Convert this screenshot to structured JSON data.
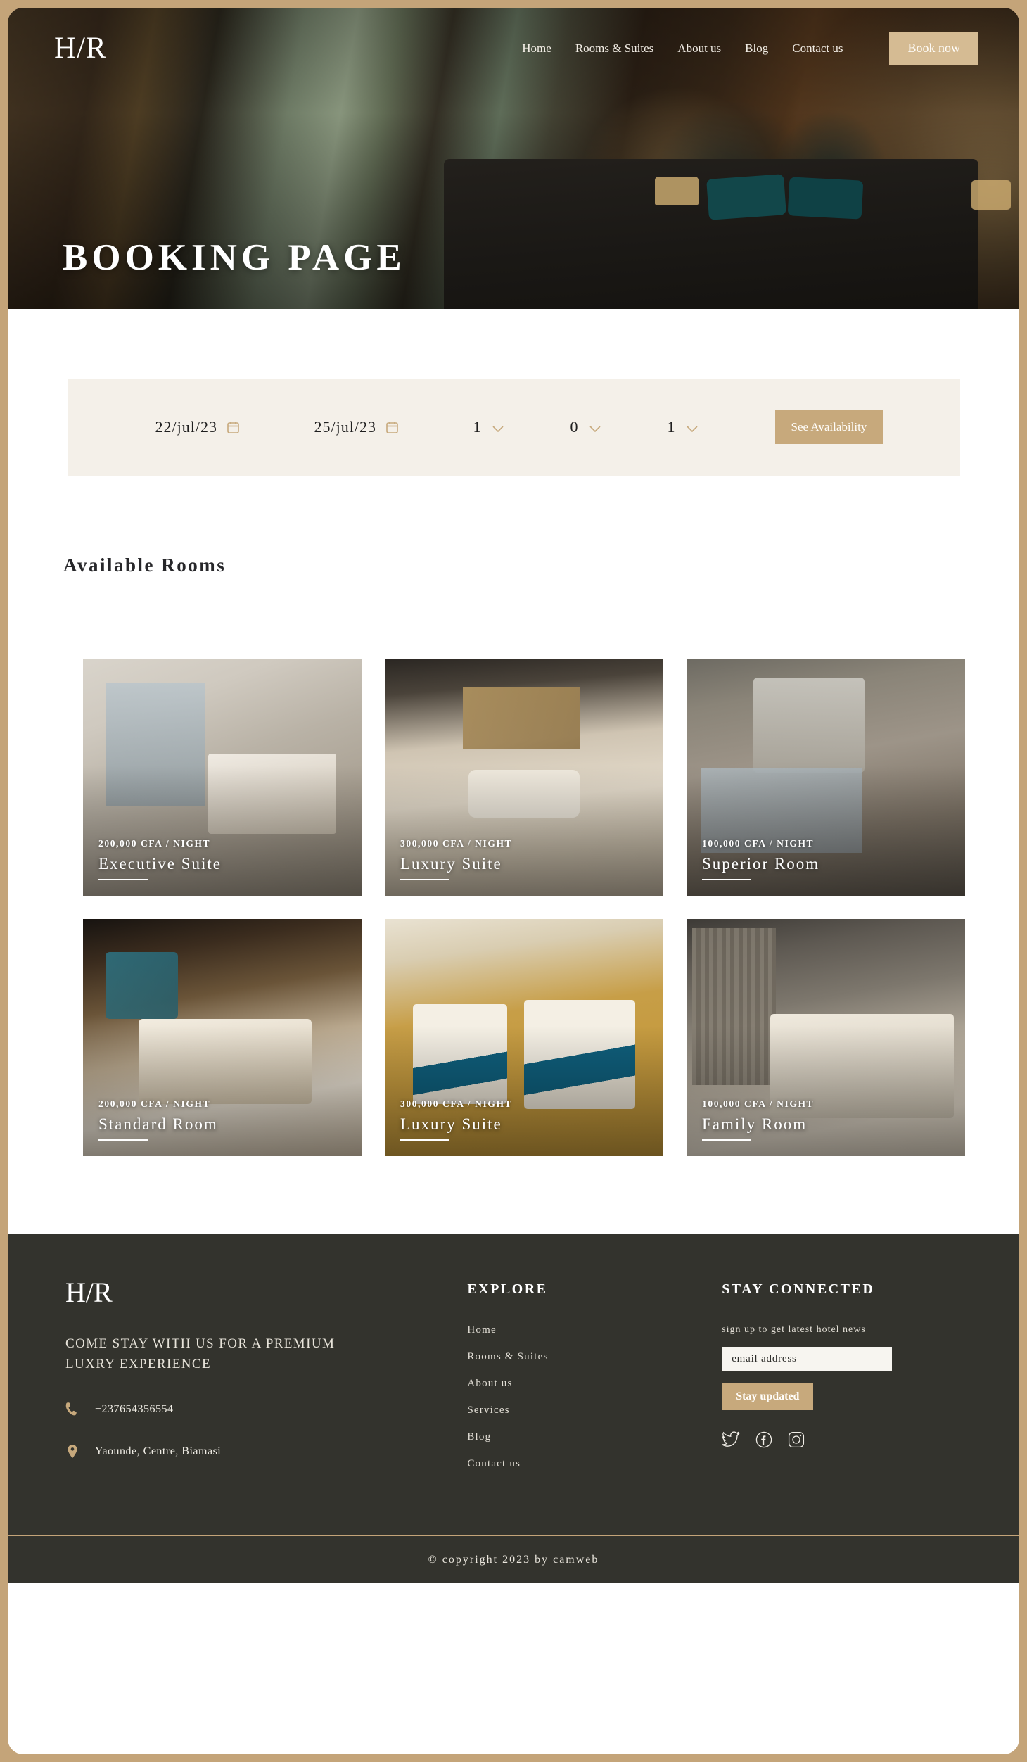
{
  "brand": {
    "logo": "H/R"
  },
  "nav": {
    "links": [
      {
        "label": "Home"
      },
      {
        "label": "Rooms & Suites"
      },
      {
        "label": "About us"
      },
      {
        "label": "Blog"
      },
      {
        "label": "Contact us"
      }
    ],
    "cta": "Book now"
  },
  "hero": {
    "title": "BOOKING PAGE"
  },
  "booking": {
    "check_in": "22/jul/23",
    "check_out": "25/jul/23",
    "adults": "1",
    "children": "0",
    "rooms": "1",
    "submit": "See Availability"
  },
  "rooms_section": {
    "title": "Available Rooms",
    "cards": [
      {
        "price": "200,000 CFA / NIGHT",
        "name": "Executive Suite",
        "img": "img-exec"
      },
      {
        "price": "300,000 CFA / NIGHT",
        "name": "Luxury Suite",
        "img": "img-lux"
      },
      {
        "price": "100,000 CFA / NIGHT",
        "name": "Superior Room",
        "img": "img-sup"
      },
      {
        "price": "200,000 CFA / NIGHT",
        "name": "Standard Room",
        "img": "img-std"
      },
      {
        "price": "300,000 CFA / NIGHT",
        "name": "Luxury Suite",
        "img": "img-lux2"
      },
      {
        "price": "100,000 CFA / NIGHT",
        "name": "Family Room",
        "img": "img-fam"
      }
    ]
  },
  "footer": {
    "logo": "H/R",
    "tagline": "COME STAY WITH US FOR A PREMIUM LUXRY EXPERIENCE",
    "phone": "+237654356554",
    "address": "Yaounde, Centre, Biamasi",
    "explore": {
      "heading": "EXPLORE",
      "links": [
        {
          "label": "Home"
        },
        {
          "label": "Rooms & Suites"
        },
        {
          "label": "About us"
        },
        {
          "label": "Services"
        },
        {
          "label": "Blog"
        },
        {
          "label": "Contact us"
        }
      ]
    },
    "connected": {
      "heading": "STAY CONNECTED",
      "hint": "sign up to get latest hotel news",
      "email_placeholder": "email address",
      "email_value": "",
      "submit": "Stay updated",
      "socials": [
        {
          "name": "twitter"
        },
        {
          "name": "facebook"
        },
        {
          "name": "instagram"
        }
      ]
    },
    "copyright": "© copyright 2023 by camweb"
  },
  "colors": {
    "accent": "#c7a97c",
    "frame": "#c4a479",
    "footer_bg": "#33332d",
    "bar_bg": "#f4f0e9"
  }
}
